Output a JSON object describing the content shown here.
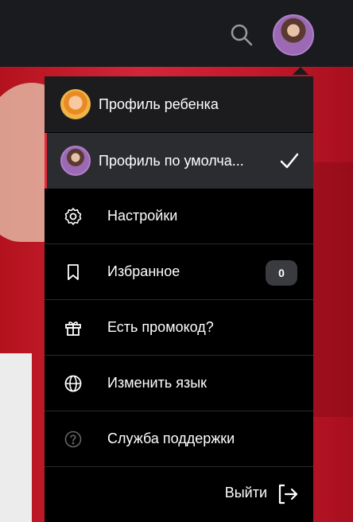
{
  "profiles": [
    {
      "label": "Профиль ребенка",
      "active": false
    },
    {
      "label": "Профиль по умолча...",
      "active": true
    }
  ],
  "menu_items": [
    {
      "label": "Настройки",
      "icon": "gear-icon"
    },
    {
      "label": "Избранное",
      "icon": "bookmark-icon",
      "badge": "0"
    },
    {
      "label": "Есть промокод?",
      "icon": "gift-icon"
    },
    {
      "label": "Изменить язык",
      "icon": "globe-icon"
    },
    {
      "label": "Служба поддержки",
      "icon": "help-icon"
    }
  ],
  "logout_label": "Выйти",
  "colors": {
    "header": "#1a1b1f",
    "menu_bg": "#000000",
    "accent": "#e8283c",
    "active_row": "#2b2c30"
  }
}
